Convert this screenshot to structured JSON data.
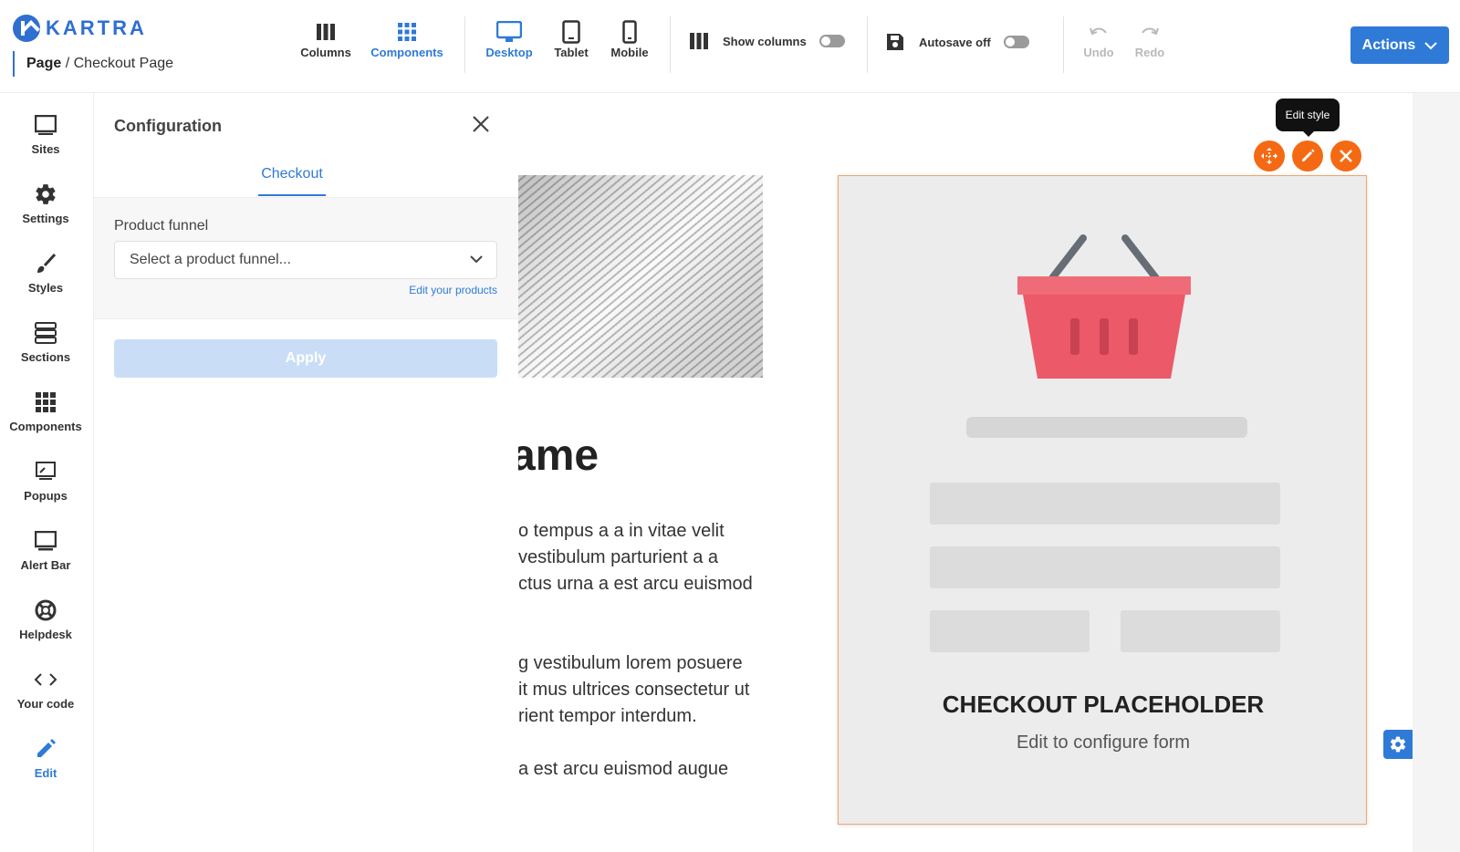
{
  "brand": {
    "name": "KARTRA"
  },
  "breadcrumb": {
    "section": "Page",
    "separator": "/",
    "page": "Checkout Page"
  },
  "toolbar": {
    "columns": "Columns",
    "components": "Components",
    "desktop": "Desktop",
    "tablet": "Tablet",
    "mobile": "Mobile",
    "show_columns": "Show columns",
    "autosave": "Autosave off",
    "undo": "Undo",
    "redo": "Redo",
    "actions": "Actions"
  },
  "leftnav": [
    {
      "label": "Sites",
      "icon": "sites-icon"
    },
    {
      "label": "Settings",
      "icon": "gear-icon"
    },
    {
      "label": "Styles",
      "icon": "brush-icon"
    },
    {
      "label": "Sections",
      "icon": "sections-icon"
    },
    {
      "label": "Components",
      "icon": "grid-icon"
    },
    {
      "label": "Popups",
      "icon": "popup-icon"
    },
    {
      "label": "Alert Bar",
      "icon": "alert-bar-icon"
    },
    {
      "label": "Helpdesk",
      "icon": "lifebuoy-icon"
    },
    {
      "label": "Your code",
      "icon": "code-icon"
    },
    {
      "label": "Edit",
      "icon": "pencil-icon"
    }
  ],
  "config": {
    "title": "Configuration",
    "tab": "Checkout",
    "funnel_label": "Product funnel",
    "funnel_placeholder": "Select a product funnel...",
    "edit_link": "Edit your products",
    "apply": "Apply"
  },
  "canvas": {
    "heading": "ame",
    "para1": [
      "o tempus a a in vitae velit",
      " vestibulum parturient a a",
      "ctus urna a est arcu euismod"
    ],
    "para2": [
      "g vestibulum lorem posuere",
      "it mus ultrices consectetur ut",
      "rient tempor interdum."
    ],
    "para3": [
      "a est arcu euismod augue"
    ],
    "checkout_title": "CHECKOUT PLACEHOLDER",
    "checkout_subtitle": "Edit to configure form",
    "tooltip": "Edit style"
  },
  "colors": {
    "accent": "#2f7ad7",
    "orange": "#f46a14",
    "basket": "#ee5c6c"
  }
}
